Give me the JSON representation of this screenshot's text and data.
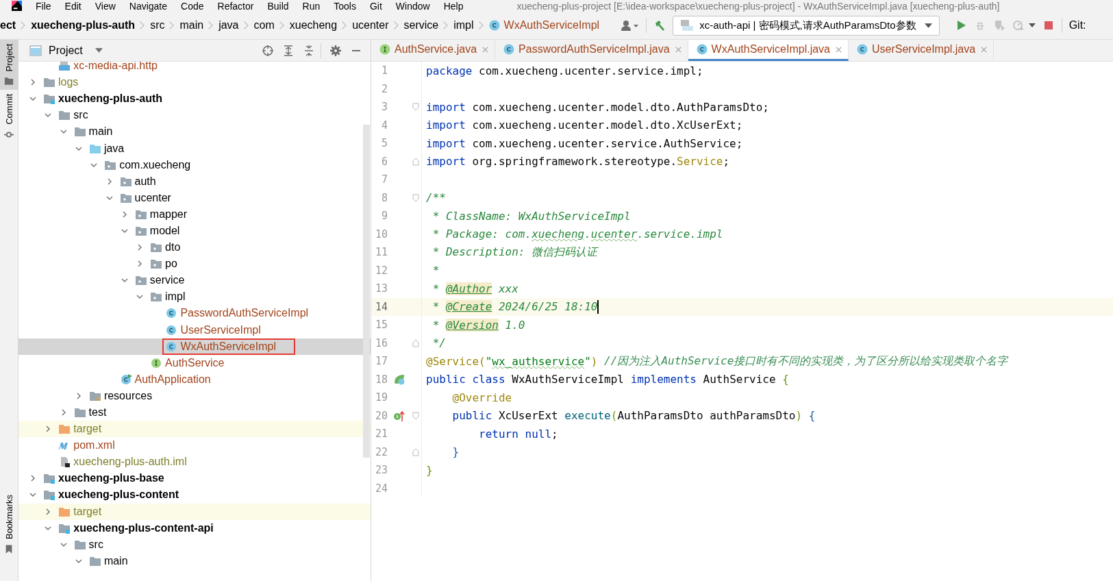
{
  "menu_bar": {
    "items": [
      "File",
      "Edit",
      "View",
      "Navigate",
      "Code",
      "Refactor",
      "Build",
      "Run",
      "Tools",
      "Git",
      "Window",
      "Help"
    ],
    "title": "xuecheng-plus-project [E:\\idea-workspace\\xuecheng-plus-project] - WxAuthServiceImpl.java [xuecheng-plus-auth]"
  },
  "breadcrumb": [
    {
      "label": "ect",
      "kind": "module"
    },
    {
      "label": "xuecheng-plus-auth",
      "kind": "module"
    },
    {
      "label": "src",
      "kind": "folder"
    },
    {
      "label": "main",
      "kind": "folder"
    },
    {
      "label": "java",
      "kind": "folder"
    },
    {
      "label": "com",
      "kind": "folder"
    },
    {
      "label": "xuecheng",
      "kind": "folder"
    },
    {
      "label": "ucenter",
      "kind": "folder"
    },
    {
      "label": "service",
      "kind": "folder"
    },
    {
      "label": "impl",
      "kind": "folder"
    },
    {
      "label": "WxAuthServiceImpl",
      "kind": "class"
    }
  ],
  "toolbar": {
    "run_config": "xc-auth-api | 密码模式,请求AuthParamsDto参数",
    "git_label": "Git:"
  },
  "side_stripe": {
    "top": [
      {
        "label": "Project",
        "kind": "project",
        "selected": true
      },
      {
        "label": "Commit",
        "kind": "commit",
        "selected": false
      }
    ],
    "bottom": [
      {
        "label": "Bookmarks",
        "kind": "bookmarks",
        "selected": false
      }
    ]
  },
  "project_panel": {
    "title": "Project",
    "tree_above": [
      {
        "label": "xc-media-api.http",
        "kind": "http",
        "color": "#a2441b",
        "selected": false
      }
    ],
    "tree": [
      {
        "label": "logs",
        "kind": "folder",
        "color": "#7f7f2c",
        "expanded": false,
        "selected": false
      },
      {
        "label": "xuecheng-plus-auth",
        "kind": "module",
        "expanded": true,
        "selected": false,
        "children": [
          {
            "label": "src",
            "kind": "folder",
            "expanded": true,
            "selected": false,
            "children": [
              {
                "label": "main",
                "kind": "folder",
                "expanded": true,
                "selected": false,
                "children": [
                  {
                    "label": "java",
                    "kind": "source_root",
                    "expanded": true,
                    "selected": false,
                    "children": [
                      {
                        "label": "com.xuecheng",
                        "kind": "package",
                        "expanded": true,
                        "selected": false,
                        "children": [
                          {
                            "label": "auth",
                            "kind": "package",
                            "expanded": false,
                            "selected": false
                          },
                          {
                            "label": "ucenter",
                            "kind": "package",
                            "expanded": true,
                            "selected": false,
                            "children": [
                              {
                                "label": "mapper",
                                "kind": "package",
                                "expanded": false,
                                "selected": false
                              },
                              {
                                "label": "model",
                                "kind": "package",
                                "expanded": true,
                                "selected": false,
                                "children": [
                                  {
                                    "label": "dto",
                                    "kind": "package",
                                    "expanded": false,
                                    "selected": false
                                  },
                                  {
                                    "label": "po",
                                    "kind": "package",
                                    "expanded": false,
                                    "selected": false
                                  }
                                ]
                              },
                              {
                                "label": "service",
                                "kind": "package",
                                "expanded": true,
                                "selected": false,
                                "children": [
                                  {
                                    "label": "impl",
                                    "kind": "package",
                                    "expanded": true,
                                    "selected": false,
                                    "children": [
                                      {
                                        "label": "PasswordAuthServiceImpl",
                                        "kind": "class",
                                        "color": "#a2441b",
                                        "selected": false
                                      },
                                      {
                                        "label": "UserServiceImpl",
                                        "kind": "class",
                                        "color": "#a2441b",
                                        "selected": false
                                      },
                                      {
                                        "label": "WxAuthServiceImpl",
                                        "kind": "class",
                                        "color": "#a2441b",
                                        "selected": true,
                                        "boxed": true
                                      }
                                    ]
                                  },
                                  {
                                    "label": "AuthService",
                                    "kind": "interface",
                                    "color": "#a2441b",
                                    "selected": false
                                  }
                                ]
                              }
                            ]
                          },
                          {
                            "label": "AuthApplication",
                            "kind": "app_class",
                            "color": "#a2441b",
                            "selected": false
                          }
                        ]
                      }
                    ]
                  },
                  {
                    "label": "resources",
                    "kind": "resources",
                    "expanded": false,
                    "selected": false
                  }
                ]
              },
              {
                "label": "test",
                "kind": "folder",
                "expanded": false,
                "selected": false
              }
            ]
          },
          {
            "label": "target",
            "kind": "excluded",
            "color": "#7f7f2c",
            "expanded": false,
            "selected": false
          },
          {
            "label": "pom.xml",
            "kind": "maven",
            "color": "#a2441b",
            "selected": false
          },
          {
            "label": "xuecheng-plus-auth.iml",
            "kind": "iml",
            "color": "#7f7f2c",
            "selected": false
          }
        ]
      },
      {
        "label": "xuecheng-plus-base",
        "kind": "module",
        "expanded": false,
        "selected": false
      },
      {
        "label": "xuecheng-plus-content",
        "kind": "module",
        "expanded": true,
        "selected": false,
        "children": [
          {
            "label": "target",
            "kind": "excluded",
            "color": "#7f7f2c",
            "expanded": false,
            "selected": false
          },
          {
            "label": "xuecheng-plus-content-api",
            "kind": "module",
            "expanded": true,
            "selected": false,
            "children": [
              {
                "label": "src",
                "kind": "folder",
                "expanded": true,
                "selected": false,
                "children": [
                  {
                    "label": "main",
                    "kind": "folder",
                    "expanded": true,
                    "selected": false
                  }
                ]
              }
            ]
          }
        ]
      }
    ]
  },
  "editor": {
    "tabs": [
      {
        "label": "AuthService.java",
        "kind": "interface",
        "selected": false
      },
      {
        "label": "PasswordAuthServiceImpl.java",
        "kind": "class",
        "selected": false
      },
      {
        "label": "WxAuthServiceImpl.java",
        "kind": "class",
        "selected": true
      },
      {
        "label": "UserServiceImpl.java",
        "kind": "class",
        "selected": false
      }
    ],
    "lines": [
      {
        "number": "1",
        "tokens": [
          {
            "text": "package",
            "kind": "keyword"
          },
          {
            "text": " com.xuecheng.ucenter.service.impl;",
            "kind": "plain"
          }
        ]
      },
      {
        "number": "2"
      },
      {
        "number": "3",
        "markers": [
          {
            "kind": "fold_start"
          }
        ],
        "tokens": [
          {
            "text": "import",
            "kind": "keyword"
          },
          {
            "text": " com.xuecheng.ucenter.model.dto.AuthParamsDto;",
            "kind": "plain"
          }
        ]
      },
      {
        "number": "4",
        "tokens": [
          {
            "text": "import",
            "kind": "keyword"
          },
          {
            "text": " com.xuecheng.ucenter.model.dto.XcUserExt;",
            "kind": "plain"
          }
        ]
      },
      {
        "number": "5",
        "tokens": [
          {
            "text": "import",
            "kind": "keyword"
          },
          {
            "text": " com.xuecheng.ucenter.service.AuthService;",
            "kind": "plain"
          }
        ]
      },
      {
        "number": "6",
        "markers": [
          {
            "kind": "fold_end"
          }
        ],
        "tokens": [
          {
            "text": "import",
            "kind": "keyword"
          },
          {
            "text": " org.springframework.stereotype.",
            "kind": "plain"
          },
          {
            "text": "Service",
            "kind": "annotation"
          },
          {
            "text": ";",
            "kind": "plain"
          }
        ]
      },
      {
        "number": "7"
      },
      {
        "number": "8",
        "markers": [
          {
            "kind": "fold_start"
          }
        ],
        "tokens": [
          {
            "text": "/**",
            "kind": "doc"
          }
        ]
      },
      {
        "number": "9",
        "tokens": [
          {
            "text": " * ClassName: WxAuthServiceImpl",
            "kind": "doc"
          }
        ]
      },
      {
        "number": "10",
        "tokens": [
          {
            "text": " * Package: com.",
            "kind": "doc"
          },
          {
            "text": "xuecheng",
            "kind": "doc",
            "typo": true
          },
          {
            "text": ".",
            "kind": "doc"
          },
          {
            "text": "ucenter",
            "kind": "doc",
            "typo": true
          },
          {
            "text": ".service.impl",
            "kind": "doc"
          }
        ]
      },
      {
        "number": "11",
        "tokens": [
          {
            "text": " * Description: 微信扫码认证",
            "kind": "doc"
          }
        ]
      },
      {
        "number": "12",
        "tokens": [
          {
            "text": " *",
            "kind": "doc"
          }
        ]
      },
      {
        "number": "13",
        "tokens": [
          {
            "text": " * ",
            "kind": "doc"
          },
          {
            "text": "@Author",
            "kind": "doc_tag"
          },
          {
            "text": " xxx",
            "kind": "doc"
          }
        ]
      },
      {
        "number": "14",
        "current": true,
        "caret": true,
        "tokens": [
          {
            "text": " * ",
            "kind": "doc"
          },
          {
            "text": "@Create",
            "kind": "doc_tag"
          },
          {
            "text": " 2024/6/25 18:10",
            "kind": "doc"
          }
        ]
      },
      {
        "number": "15",
        "tokens": [
          {
            "text": " * ",
            "kind": "doc"
          },
          {
            "text": "@Version",
            "kind": "doc_tag"
          },
          {
            "text": " 1.0",
            "kind": "doc"
          }
        ]
      },
      {
        "number": "16",
        "markers": [
          {
            "kind": "fold_end"
          }
        ],
        "tokens": [
          {
            "text": " */",
            "kind": "doc"
          }
        ]
      },
      {
        "number": "17",
        "tokens": [
          {
            "text": "@Service(",
            "kind": "annotation"
          },
          {
            "text": "\"",
            "kind": "string"
          },
          {
            "text": "wx_authservice",
            "kind": "string",
            "typo": true
          },
          {
            "text": "\"",
            "kind": "string"
          },
          {
            "text": ") ",
            "kind": "annotation"
          },
          {
            "text": "//因为注入AuthService接口时有不同的实现类，为了区分所以给实现类取个名字",
            "kind": "comment"
          }
        ]
      },
      {
        "number": "18",
        "markers": [
          {
            "kind": "bean"
          }
        ],
        "tokens": [
          {
            "text": "public ",
            "kind": "keyword"
          },
          {
            "text": "class",
            "kind": "keyword"
          },
          {
            "text": " WxAuthServiceImpl ",
            "kind": "plain"
          },
          {
            "text": "implements",
            "kind": "keyword"
          },
          {
            "text": " AuthService ",
            "kind": "plain"
          },
          {
            "text": "{",
            "kind": "brace"
          }
        ]
      },
      {
        "number": "19",
        "tokens": [
          {
            "text": "    @Override",
            "kind": "annotation"
          }
        ]
      },
      {
        "number": "20",
        "markers": [
          {
            "kind": "implements"
          },
          {
            "kind": "fold_start"
          }
        ],
        "tokens": [
          {
            "text": "    public",
            "kind": "keyword"
          },
          {
            "text": " XcUserExt ",
            "kind": "plain"
          },
          {
            "text": "execute",
            "kind": "method"
          },
          {
            "text": "(",
            "kind": "brace"
          },
          {
            "text": "AuthParamsDto authParamsDto",
            "kind": "plain"
          },
          {
            "text": ") ",
            "kind": "brace"
          },
          {
            "text": "{",
            "kind": "brace_inner"
          }
        ]
      },
      {
        "number": "21",
        "tokens": [
          {
            "text": "        return null",
            "kind": "keyword"
          },
          {
            "text": ";",
            "kind": "plain"
          }
        ]
      },
      {
        "number": "22",
        "markers": [
          {
            "kind": "fold_end"
          }
        ],
        "tokens": [
          {
            "text": "    }",
            "kind": "brace_inner"
          }
        ]
      },
      {
        "number": "23",
        "tokens": [
          {
            "text": "}",
            "kind": "brace"
          }
        ]
      },
      {
        "number": "24"
      }
    ]
  }
}
